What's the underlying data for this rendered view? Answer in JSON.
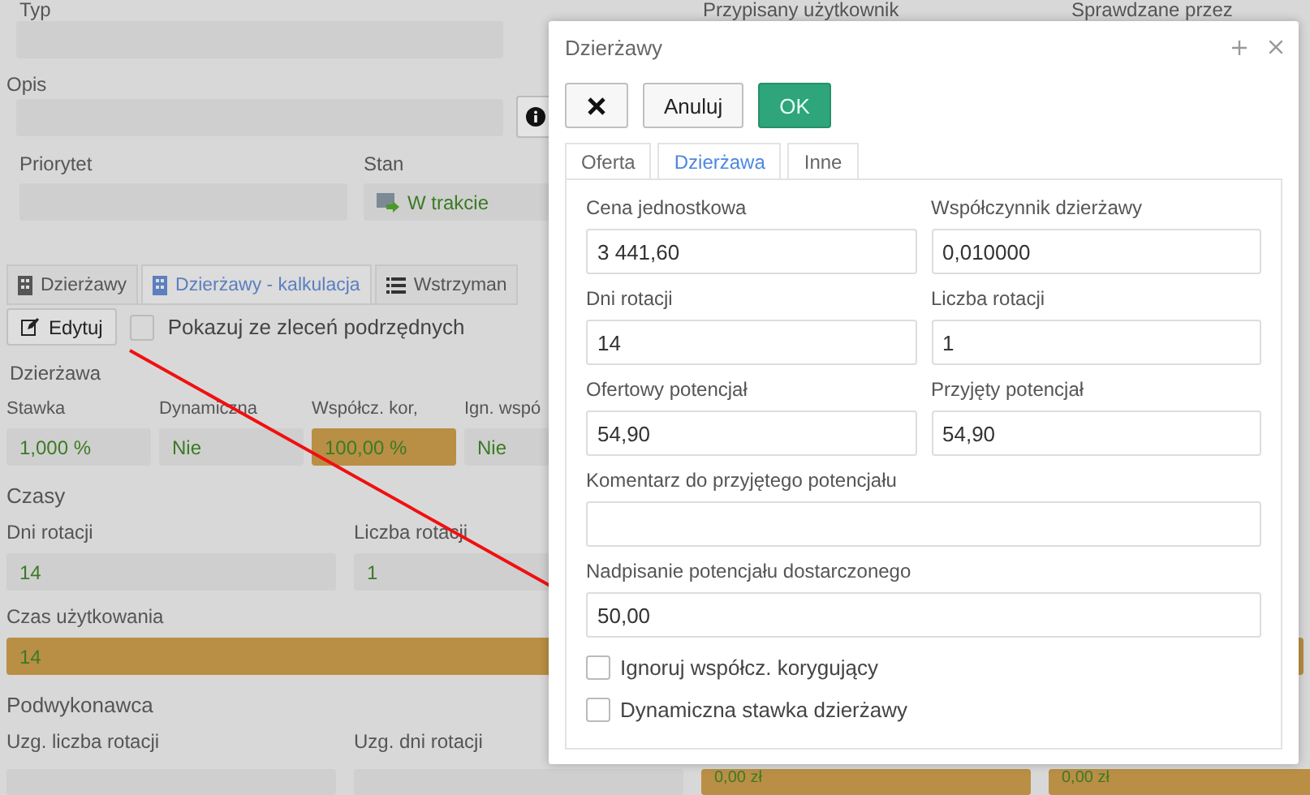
{
  "form": {
    "top_labels": [
      "Typ",
      "Przypisany użytkownik",
      "Sprawdzane przez"
    ],
    "opis_label": "Opis",
    "priorytet_label": "Priorytet",
    "stan": {
      "label": "Stan",
      "value": "W trakcie"
    }
  },
  "tabs": [
    {
      "label": "Dzierżawy",
      "selected": false
    },
    {
      "label": "Dzierżawy - kalkulacja",
      "selected": true
    },
    {
      "label": "Wstrzyman",
      "selected": false
    }
  ],
  "toolbar": {
    "edit_button": "Edytuj",
    "checkbox": {
      "label": "Pokazuj ze zleceń podrzędnych",
      "checked": false
    }
  },
  "dzierzawa": {
    "title": "Dzierżawa",
    "fields": [
      {
        "label": "Stawka",
        "value": "1,000 %",
        "highlighted": false
      },
      {
        "label": "Dynamiczna",
        "value": "Nie",
        "highlighted": false
      },
      {
        "label": "Współcz. kor,",
        "value": "100,00 %",
        "highlighted": true
      },
      {
        "label": "Ign. wspó",
        "value": "Nie",
        "highlighted": false
      }
    ]
  },
  "czasy": {
    "title": "Czasy",
    "fields": [
      {
        "label": "Dni rotacji",
        "value": "14",
        "highlighted": false
      },
      {
        "label": "Liczba rotacji",
        "value": "1",
        "highlighted": false
      }
    ],
    "usage": {
      "label": "Czas użytkowania",
      "value": "14",
      "highlighted": true
    }
  },
  "podwykonawca": {
    "title": "Podwykonawca",
    "labels": [
      "Uzg. liczba rotacji",
      "Uzg. dni rotacji"
    ],
    "cells": [
      {
        "value": "0,00 zł",
        "highlighted": true
      },
      {
        "value": "0,00 zł",
        "highlighted": true
      }
    ]
  },
  "modal": {
    "title": "Dzierżawy",
    "buttons": [
      {
        "kind": "close"
      },
      {
        "kind": "cancel",
        "label": "Anuluj"
      },
      {
        "kind": "ok",
        "label": "OK"
      }
    ],
    "tabs": [
      {
        "label": "Oferta",
        "selected": false
      },
      {
        "label": "Dzierżawa",
        "selected": true
      },
      {
        "label": "Inne",
        "selected": false
      }
    ],
    "rows": [
      [
        {
          "label": "Cena jednostkowa",
          "value": "3 441,60"
        },
        {
          "label": "Współczynnik dzierżawy",
          "value": "0,010000"
        }
      ],
      [
        {
          "label": "Dni rotacji",
          "value": "14"
        },
        {
          "label": "Liczba rotacji",
          "value": "1"
        }
      ],
      [
        {
          "label": "Ofertowy potencjał",
          "value": "54,90"
        },
        {
          "label": "Przyjęty potencjał",
          "value": "54,90"
        }
      ],
      [
        {
          "label": "Komentarz do przyjętego potencjału"
        }
      ],
      [
        {
          "label": "Nadpisanie potencjału dostarczonego",
          "value": "50,00"
        }
      ]
    ],
    "checkboxes": [
      {
        "label": "Ignoruj współcz. korygujący",
        "checked": false
      },
      {
        "label": "Dynamiczna stawka dzierżawy",
        "checked": false
      }
    ]
  }
}
